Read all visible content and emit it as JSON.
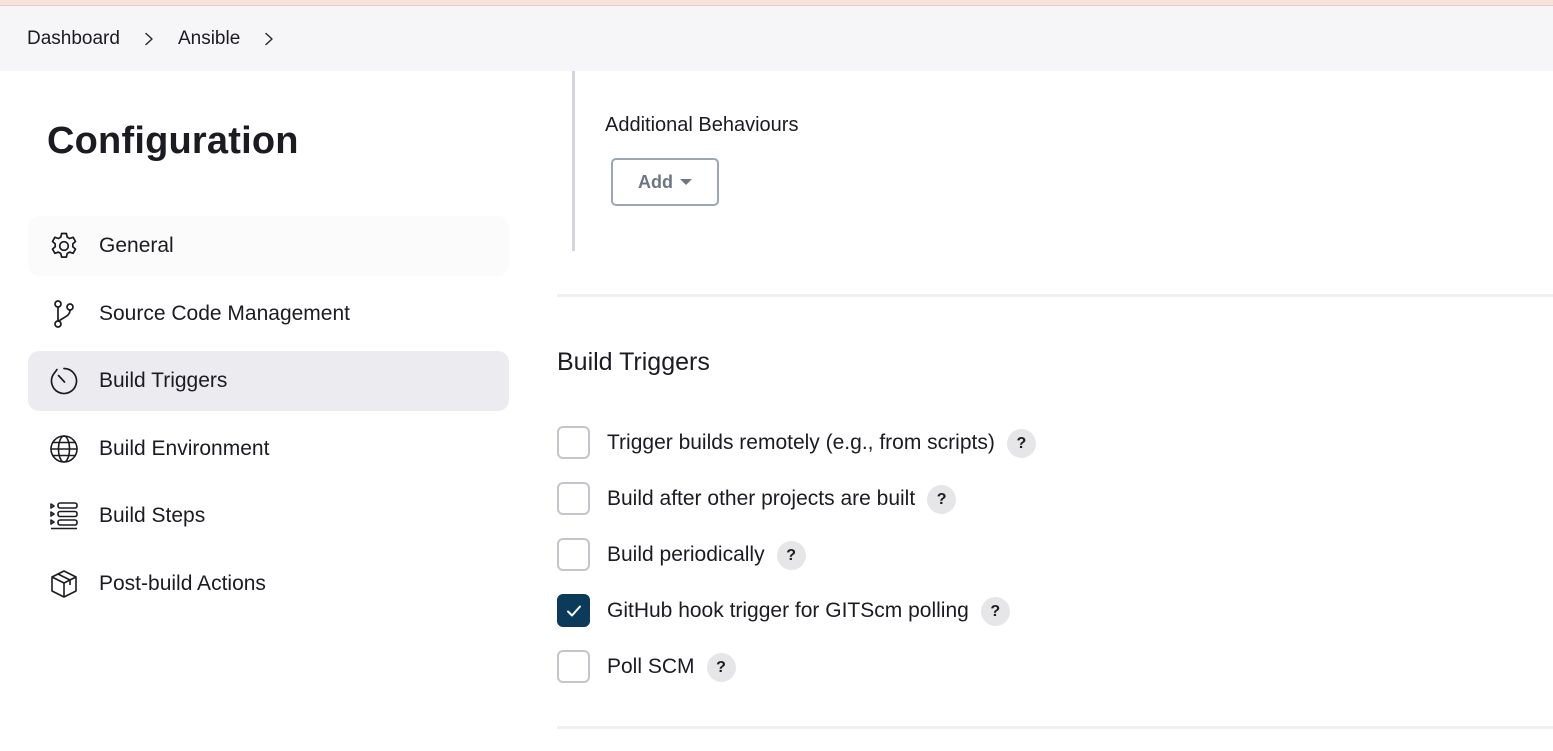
{
  "breadcrumb": {
    "items": [
      {
        "label": "Dashboard"
      },
      {
        "label": "Ansible"
      }
    ]
  },
  "page": {
    "title": "Configuration"
  },
  "sidebar": {
    "items": [
      {
        "label": "General",
        "icon": "gear-icon"
      },
      {
        "label": "Source Code Management",
        "icon": "git-branch-icon"
      },
      {
        "label": "Build Triggers",
        "icon": "timer-icon",
        "active": true
      },
      {
        "label": "Build Environment",
        "icon": "globe-icon"
      },
      {
        "label": "Build Steps",
        "icon": "list-steps-icon"
      },
      {
        "label": "Post-build Actions",
        "icon": "package-icon"
      }
    ]
  },
  "scm_section": {
    "additional_behaviours_label": "Additional Behaviours",
    "add_button_label": "Add"
  },
  "build_triggers": {
    "heading": "Build Triggers",
    "options": [
      {
        "label": "Trigger builds remotely (e.g., from scripts)",
        "checked": false,
        "help": "?"
      },
      {
        "label": "Build after other projects are built",
        "checked": false,
        "help": "?"
      },
      {
        "label": "Build periodically",
        "checked": false,
        "help": "?"
      },
      {
        "label": "GitHub hook trigger for GITScm polling",
        "checked": true,
        "help": "?"
      },
      {
        "label": "Poll SCM",
        "checked": false,
        "help": "?"
      }
    ]
  },
  "colors": {
    "checkbox_checked": "#0b3a5b",
    "active_nav_bg": "#ececf0",
    "breadcrumb_bg": "#f6f6f8"
  }
}
